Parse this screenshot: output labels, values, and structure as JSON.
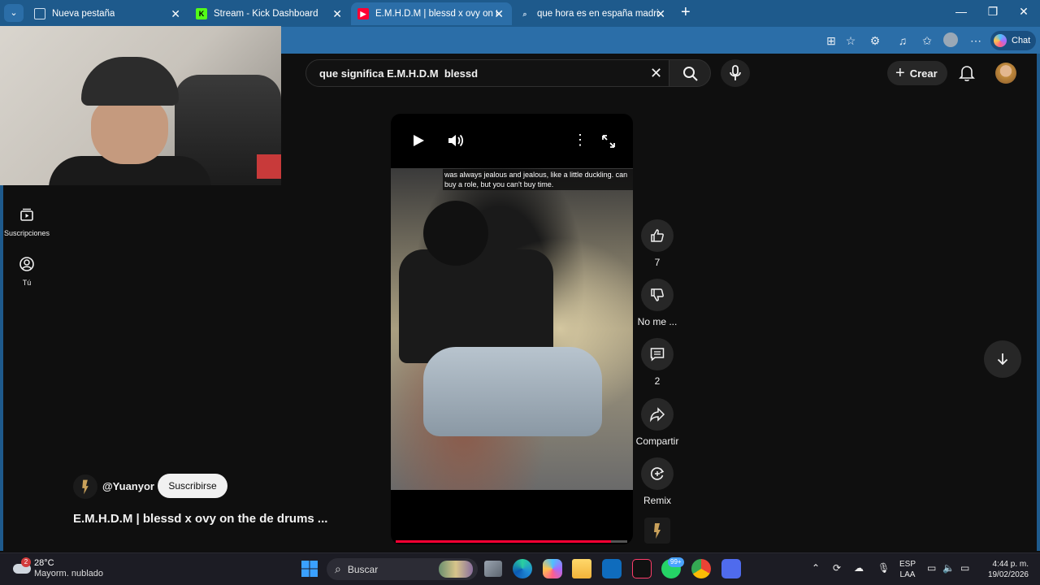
{
  "browser": {
    "tabs": [
      {
        "title": "Nueva pestaña",
        "active": false
      },
      {
        "title": "Stream - Kick Dashboard",
        "active": false
      },
      {
        "title": "E.M.H.D.M | blessd x ovy on the de",
        "active": true
      },
      {
        "title": "que hora es en españa madrid - B",
        "active": false
      }
    ],
    "chat_label": "Chat"
  },
  "sidebar": {
    "items": [
      {
        "label": "Suscripciones",
        "icon": "subscriptions-icon"
      },
      {
        "label": "Tú",
        "icon": "you-icon"
      }
    ]
  },
  "header": {
    "search_value": "que significa E.M.H.D.M  blessd",
    "create_label": "Crear"
  },
  "video": {
    "caption_line1": "was always jealous and jealous, like a little duckling. can",
    "caption_line2": "buy a role, but you can't buy time.",
    "progress_fraction": 0.93
  },
  "actions": {
    "likes": "7",
    "dislike_label": "No me ...",
    "comments": "2",
    "share_label": "Compartir",
    "remix_label": "Remix"
  },
  "meta": {
    "channel": "@Yuanyor",
    "subscribe_label": "Suscribirse",
    "title": "E.M.H.D.M | blessd x ovy on the de drums ..."
  },
  "taskbar": {
    "weather_temp": "28°C",
    "weather_desc": "Mayorm. nublado",
    "weather_badge": "2",
    "search_label": "Buscar",
    "whatsapp_badge": "99+",
    "lang_line1": "ESP",
    "lang_line2": "LAA",
    "time": "4:44 p. m.",
    "date": "19/02/2026"
  }
}
